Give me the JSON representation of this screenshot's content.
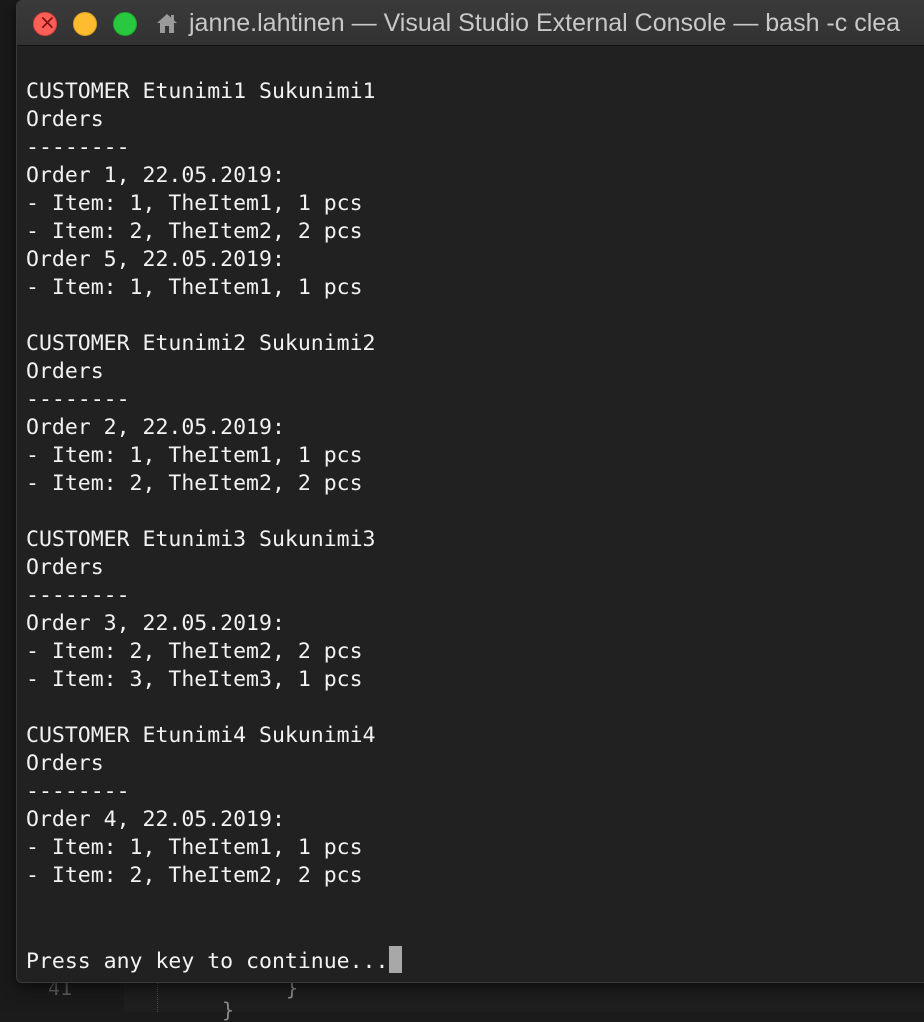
{
  "window": {
    "title": "janne.lahtinen — Visual Studio External Console — bash -c clea"
  },
  "console_lines": [
    "CUSTOMER Etunimi1 Sukunimi1",
    "Orders",
    "--------",
    "Order 1, 22.05.2019:",
    "- Item: 1, TheItem1, 1 pcs",
    "- Item: 2, TheItem2, 2 pcs",
    "Order 5, 22.05.2019:",
    "- Item: 1, TheItem1, 1 pcs",
    "",
    "CUSTOMER Etunimi2 Sukunimi2",
    "Orders",
    "--------",
    "Order 2, 22.05.2019:",
    "- Item: 1, TheItem1, 1 pcs",
    "- Item: 2, TheItem2, 2 pcs",
    "",
    "CUSTOMER Etunimi3 Sukunimi3",
    "Orders",
    "--------",
    "Order 3, 22.05.2019:",
    "- Item: 2, TheItem2, 2 pcs",
    "- Item: 3, TheItem3, 1 pcs",
    "",
    "CUSTOMER Etunimi4 Sukunimi4",
    "Orders",
    "--------",
    "Order 4, 22.05.2019:",
    "- Item: 1, TheItem1, 1 pcs",
    "- Item: 2, TheItem2, 2 pcs",
    "",
    ""
  ],
  "prompt": "Press any key to continue...",
  "background_editor": {
    "line_number": "41",
    "code_fragment_1": "}",
    "code_fragment_2": "}"
  }
}
